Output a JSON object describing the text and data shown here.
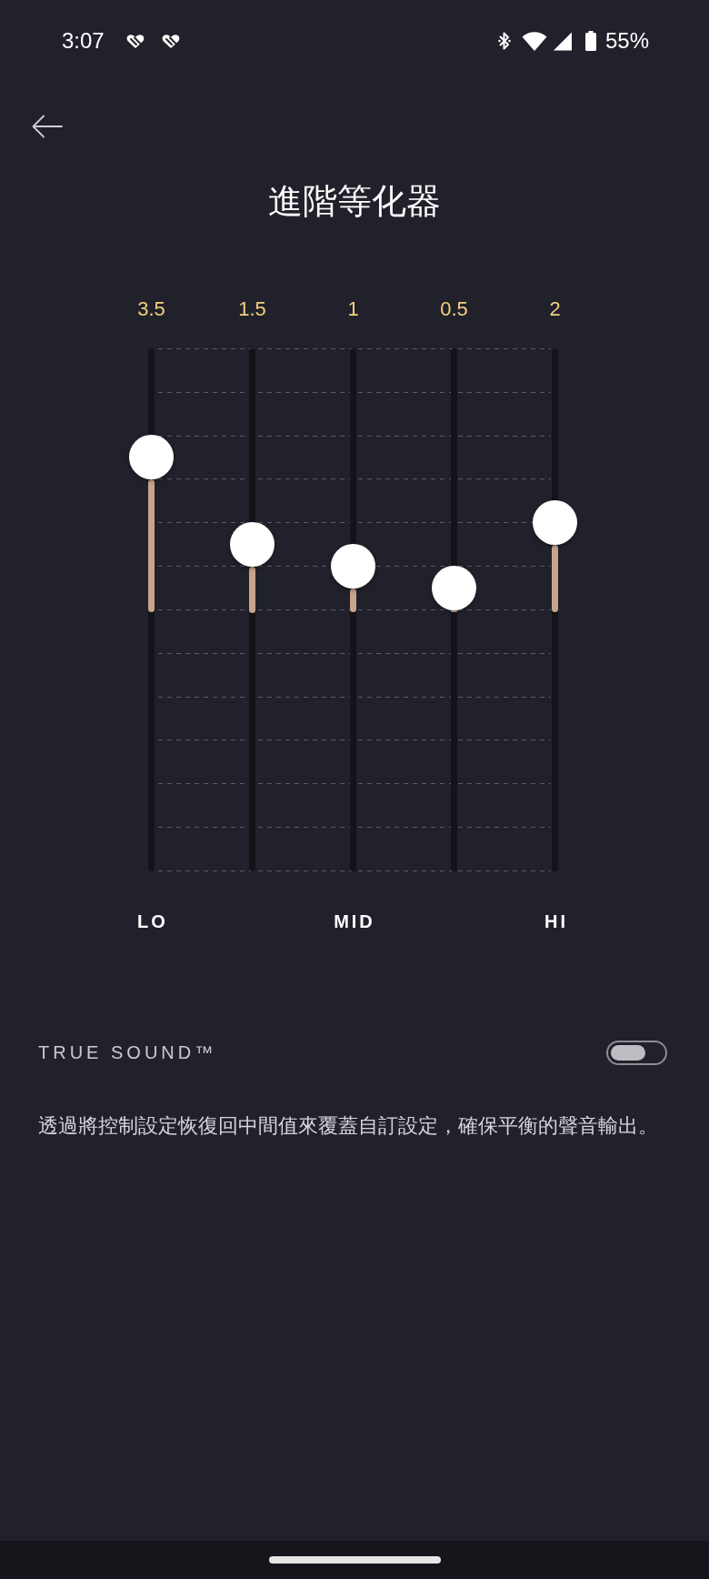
{
  "status_bar": {
    "time": "3:07",
    "battery": "55%"
  },
  "header": {
    "title": "進階等化器"
  },
  "equalizer": {
    "bands": [
      {
        "reading": "3.5",
        "level": 0.7917,
        "label": "LO"
      },
      {
        "reading": "1.5",
        "level": 0.625
      },
      {
        "reading": "1",
        "level": 0.5833,
        "label": "MID"
      },
      {
        "reading": "0.5",
        "level": 0.5417
      },
      {
        "reading": "2",
        "level": 0.6667,
        "label": "HI"
      }
    ]
  },
  "true_sound": {
    "label": "TRUE SOUND™",
    "on": false,
    "description": "透過將控制設定恢復回中間值來覆蓋自訂設定，確保平衡的聲音輸出。"
  }
}
